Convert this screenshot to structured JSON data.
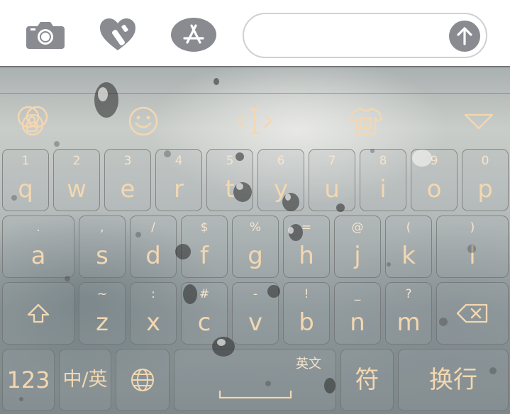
{
  "top_bar": {
    "icons": [
      "camera-icon",
      "digital-touch-icon",
      "app-store-icon"
    ],
    "send_icon": "arrow-up-icon",
    "message_value": ""
  },
  "toolbar": {
    "icons": [
      "venn-lock-icon",
      "emoji-icon",
      "cursor-move-icon",
      "tshirt-skin-icon",
      "hide-keyboard-icon"
    ]
  },
  "rows": [
    [
      {
        "hint": "1",
        "label": "q"
      },
      {
        "hint": "2",
        "label": "w"
      },
      {
        "hint": "3",
        "label": "e"
      },
      {
        "hint": "4",
        "label": "r"
      },
      {
        "hint": "5",
        "label": "t"
      },
      {
        "hint": "6",
        "label": "y"
      },
      {
        "hint": "7",
        "label": "u"
      },
      {
        "hint": "8",
        "label": "i"
      },
      {
        "hint": "9",
        "label": "o"
      },
      {
        "hint": "0",
        "label": "p"
      }
    ],
    [
      {
        "hint": ".",
        "label": "a"
      },
      {
        "hint": ",",
        "label": "s"
      },
      {
        "hint": "/",
        "label": "d"
      },
      {
        "hint": "$",
        "label": "f"
      },
      {
        "hint": "%",
        "label": "g"
      },
      {
        "hint": "=",
        "label": "h"
      },
      {
        "hint": "@",
        "label": "j"
      },
      {
        "hint": "(",
        "label": "k"
      },
      {
        "hint": ")",
        "label": "l"
      }
    ],
    [
      {
        "hint": "~",
        "label": "z"
      },
      {
        "hint": ":",
        "label": "x"
      },
      {
        "hint": "#",
        "label": "c"
      },
      {
        "hint": "-",
        "label": "v"
      },
      {
        "hint": "!",
        "label": "b"
      },
      {
        "hint": "_",
        "label": "n"
      },
      {
        "hint": "?",
        "label": "m"
      }
    ]
  ],
  "bottom": {
    "numbers_label": "123",
    "lang_switch_label": "中/英",
    "space_tag": "英文",
    "symbols_label": "符",
    "return_label": "换行"
  },
  "colors": {
    "key_text": "#f3d7b1",
    "key_border": "#6e6e6e",
    "send_button": "#8a8b91",
    "top_icons": "#8a8b91"
  }
}
